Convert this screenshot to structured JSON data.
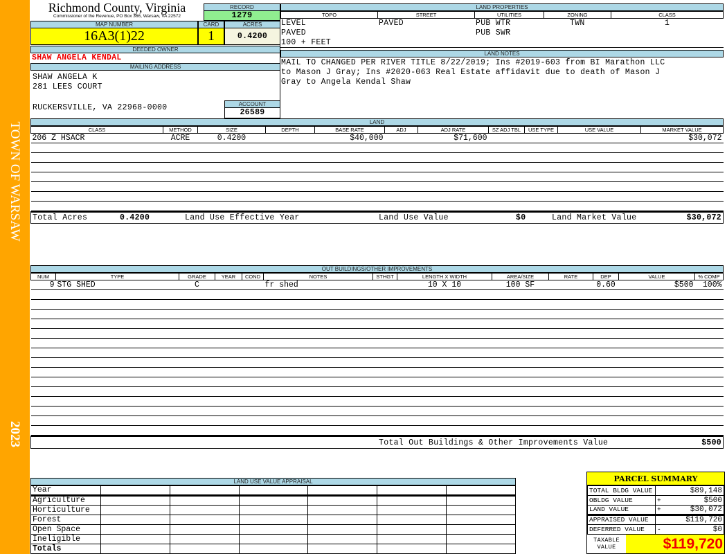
{
  "sidebar": {
    "town": "TOWN OF WARSAW",
    "year": "2023",
    "color": "#FFA500"
  },
  "header": {
    "county": "Richmond County, Virginia",
    "commissioner": "Commissioner of the Revenue, PO Box 366, Warsaw, VA 22572",
    "record_label": "RECORD",
    "record": "1279",
    "map_label": "MAP NUMBER",
    "map_number": "16A3(1)22",
    "card_label": "CARD",
    "card": "1",
    "acres_label": "ACRES",
    "acres": "0.4200",
    "owner_label": "DEEDED OWNER",
    "owner": "SHAW ANGELA KENDAL",
    "mailing_label": "MAILING ADDRESS",
    "mailing": [
      "SHAW ANGELA K",
      "281 LEES COURT",
      "RUCKERSVILLE, VA 22968-0000"
    ],
    "account_label": "ACCOUNT",
    "account": "26589"
  },
  "land_properties": {
    "label": "LAND PROPERTIES",
    "columns": [
      "TOPO",
      "STREET",
      "UTILITIES",
      "ZONING",
      "CLASS"
    ],
    "topo": [
      "LEVEL",
      "PAVED",
      "100 + FEET"
    ],
    "street": "PAVED",
    "utilities": [
      "PUB WTR",
      "PUB SWR"
    ],
    "zoning": "TWN",
    "class": "1"
  },
  "land_notes": {
    "label": "LAND NOTES",
    "lines": [
      "MAIL TO CHANGED PER RIVER TITLE 8/22/2019; Ins #2019-603 from BI Marathon LLC",
      "to Mason J Gray; Ins #2020-063 Real Estate affidavit due to death of Mason J",
      "Gray to Angela Kendal Shaw"
    ]
  },
  "land": {
    "label": "LAND",
    "columns": [
      "CLASS",
      "METHOD",
      "SIZE",
      "DEPTH",
      "BASE RATE",
      "ADJ",
      "ADJ RATE",
      "SZ ADJ TBL",
      "USE TYPE",
      "USE VALUE",
      "MARKET VALUE"
    ],
    "rows": [
      [
        "206 Z HSACR",
        "ACRE",
        "0.4200",
        "",
        "$40,000",
        "",
        "$71,600",
        "",
        "",
        "",
        "$30,072"
      ]
    ],
    "totals": {
      "acres_label": "Total Acres",
      "acres": "0.4200",
      "effective_year_label": "Land Use Effective Year",
      "use_value_label": "Land Use Value",
      "use_value": "$0",
      "market_value_label": "Land Market Value",
      "market_value": "$30,072"
    }
  },
  "outbuildings": {
    "label": "OUT BUILDINGS/OTHER IMPROVEMENTS",
    "columns": [
      "NUM",
      "TYPE",
      "GRADE",
      "YEAR",
      "COND",
      "NOTES",
      "STHGT",
      "LENGTH X WIDTH",
      "AREA/SIZE",
      "RATE",
      "DEP",
      "VALUE",
      "% COMP"
    ],
    "rows": [
      [
        "9",
        "STG SHED",
        "C",
        "",
        "",
        "fr shed",
        "",
        "10 X 10",
        "100 SF",
        "",
        "0.60",
        "$500",
        "100%"
      ]
    ],
    "total_label": "Total Out Buildings & Other Improvements Value",
    "total": "$500"
  },
  "land_use_appraisal": {
    "label": "LAND USE VALUE APPRAISAL",
    "year_label": "Year",
    "rows": [
      "Agriculture",
      "Horticulture",
      "Forest",
      "Open Space",
      "Ineligible"
    ],
    "totals_label": "Totals"
  },
  "parcel_summary": {
    "title": "PARCEL SUMMARY",
    "rows": [
      {
        "label": "TOTAL BLDG VALUE",
        "op": "",
        "value": "$89,148"
      },
      {
        "label": "OBLDG VALUE",
        "op": "+",
        "value": "$500"
      },
      {
        "label": "LAND VALUE",
        "op": "+",
        "value": "$30,072"
      },
      {
        "label": "APPRAISED VALUE",
        "op": "",
        "value": "$119,720"
      },
      {
        "label": "DEFERRED VALUE",
        "op": "-",
        "value": "$0"
      }
    ],
    "taxable_label": "TAXABLE VALUE",
    "taxable": "$119,720"
  }
}
